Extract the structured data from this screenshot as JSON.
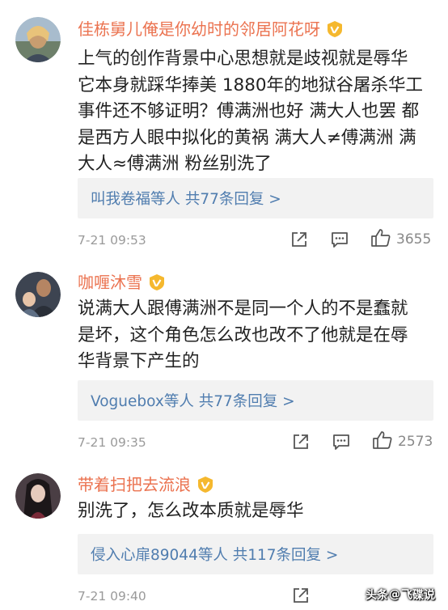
{
  "comments": [
    {
      "username": "佳栋舅儿俺是你幼时的邻居阿花呀",
      "content_lines": [
        "上气的创作背景中心思想就是歧视就是辱华",
        "它本身就踩华捧美 1880年的地狱谷屠杀华工",
        "事件还不够证明？傅满洲也好 满大人也罢 都",
        "是西方人眼中拟化的黄祸 满大人≠傅满洲 满",
        "大人≈傅满洲 粉丝别洗了"
      ],
      "replies_label": "叫我卷福等人  共77条回复 >",
      "timestamp": "7-21 09:53",
      "likes": "3655"
    },
    {
      "username": "咖喱沐雪",
      "content_lines": [
        "说满大人跟傅满洲不是同一个人的不是蠢就",
        "是坏，这个角色怎么改也改不了他就是在辱",
        "华背景下产生的"
      ],
      "replies_label": "Voguebox等人  共77条回复 >",
      "timestamp": "7-21 09:35",
      "likes": "2573"
    },
    {
      "username": "带着扫把去流浪",
      "content_lines": [
        "别洗了，怎么改本质就是辱华"
      ],
      "replies_label": "侵入心扉89044等人  共117条回复 >",
      "timestamp": "7-21 09:40",
      "likes": ""
    }
  ],
  "watermark": {
    "prefix": "头条",
    "at": "@",
    "name": "飞碟说"
  },
  "colors": {
    "username": "#eb7350",
    "link": "#507daf",
    "text": "#222222",
    "meta": "#9a9a9a",
    "reply_bg": "#f2f2f2"
  },
  "icons": [
    "vip-badge-icon",
    "share-icon",
    "reply-icon",
    "thumbs-up-icon"
  ]
}
